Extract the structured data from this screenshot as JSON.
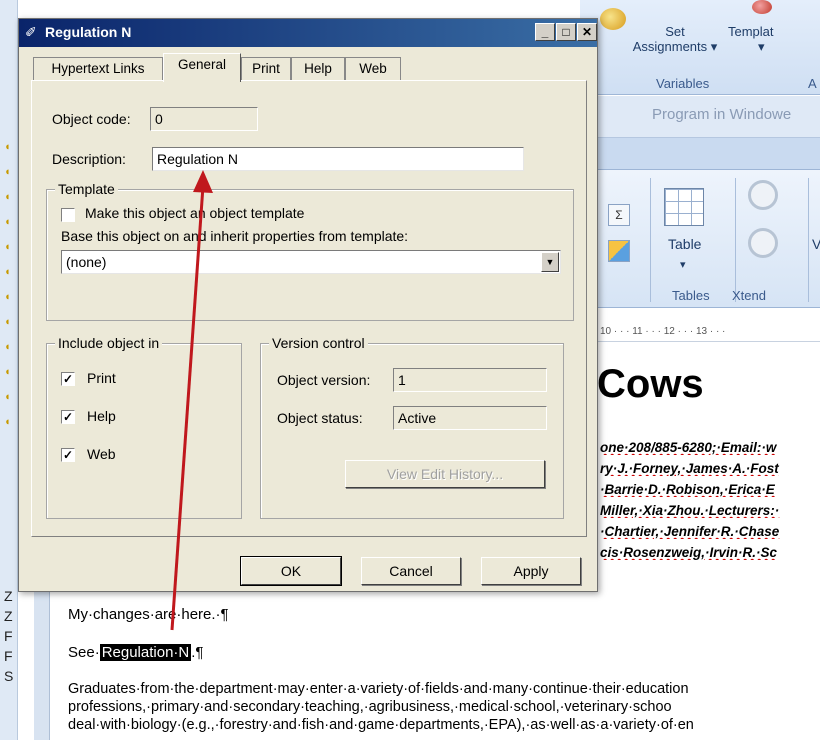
{
  "background_app": {
    "ribbon": {
      "set_assignments_line1": "Set",
      "set_assignments_line2": "Assignments ▾",
      "variables_group": "Variables",
      "templates_partial": "Templat",
      "templates_arrow": "▾",
      "group_a_partial": "A"
    },
    "program_title": "Program in Windowe",
    "ribbon2": {
      "sigma_glyph": "Σ",
      "table_label": "Table",
      "table_arrow": "▾",
      "tables_group": "Tables",
      "xtend_group": "Xtend",
      "v_partial": "V"
    },
    "ruler_text": "10 · · · 11 · · · 12 · · · 13 · · ·",
    "document": {
      "heading_fragment": "Cows",
      "fragments": [
        "one·208/885-6280;·Email:·w",
        "ry·J.·Forney,·James·A.·Fost",
        "·Barrie·D.·Robison,·Erica·E",
        "Miller,·Xia·Zhou.·Lecturers:·",
        "·Chartier,·Jennifer·R.·Chase",
        "cis·Rosenzweig,·Irvin·R.·Sc"
      ],
      "line_changes": "My·changes·are·here.·¶",
      "line_see_prefix": "See·",
      "line_see_highlight": "Regulation·N",
      "line_see_suffix": ".¶",
      "paragraph_lines": [
        "Graduates·from·the·department·may·enter·a·variety·of·fields·and·many·continue·their·education",
        "professions,·primary·and·secondary·teaching,·agribusiness,·medical·school,·veterinary·schoo",
        "deal·with·biology·(e.g.,·forestry·and·fish·and·game·departments,·EPA),·as·well·as·a·variety·of·en"
      ],
      "left_margin_letters": [
        "F",
        "F",
        "S",
        "Z",
        "Z"
      ]
    }
  },
  "dialog": {
    "title": "Regulation N",
    "title_icon": "✐",
    "window_buttons": {
      "minimize": "_",
      "maximize": "□",
      "close": "✕"
    },
    "tabs": [
      "Hypertext Links",
      "General",
      "Print",
      "Help",
      "Web"
    ],
    "active_tab": "General",
    "object_code_label": "Object code:",
    "object_code_value": "0",
    "description_label": "Description:",
    "description_value": "Regulation N",
    "template_group": {
      "label": "Template",
      "make_template_label": "Make this object an object template",
      "make_template_checked": false,
      "base_label": "Base this object on and inherit properties from template:",
      "base_value": "(none)",
      "dropdown_arrow": "▼"
    },
    "include_group": {
      "label": "Include object in",
      "items": [
        {
          "label": "Print",
          "checked": true
        },
        {
          "label": "Help",
          "checked": true
        },
        {
          "label": "Web",
          "checked": true
        }
      ],
      "check_glyph": "✓"
    },
    "version_group": {
      "label": "Version control",
      "version_label": "Object version:",
      "version_value": "1",
      "status_label": "Object status:",
      "status_value": "Active",
      "history_button": "View Edit History..."
    },
    "buttons": {
      "ok": "OK",
      "cancel": "Cancel",
      "apply": "Apply"
    }
  },
  "colors": {
    "annotation_arrow": "#c0181d",
    "titlebar_start": "#0a246a",
    "titlebar_end": "#3a6ea5",
    "dialog_face": "#ece9d8"
  }
}
